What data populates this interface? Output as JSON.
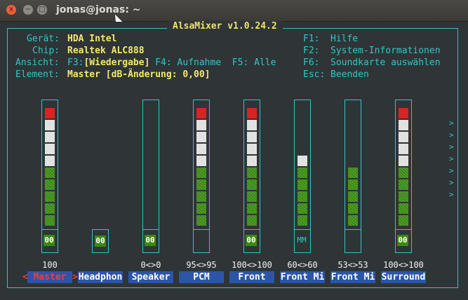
{
  "window": {
    "title": "jonas@jonas: ~",
    "close": "x",
    "min": "−",
    "max": "□"
  },
  "mixer": {
    "title": "AlsaMixer v1.0.24.2",
    "info": [
      {
        "key": "Gerät:",
        "value": "HDA Intel"
      },
      {
        "key": "Chip:",
        "value": "Realtek ALC888"
      },
      {
        "key": "Ansicht:",
        "value": "F3:[Wiedergabe] F4: Aufnahme  F5: Alle"
      },
      {
        "key": "Element:",
        "value": "Master [dB-Änderung: 0,00]"
      }
    ],
    "view_parts": {
      "f3": "F3:",
      "f3_val": "[Wiedergabe]",
      "f4": " F4: Aufnahme  F5: Alle"
    },
    "keys": [
      {
        "key": "F1:",
        "label": "Hilfe"
      },
      {
        "key": "F2:",
        "label": "System-Informationen"
      },
      {
        "key": "F6:",
        "label": "Soundkarte auswählen"
      },
      {
        "key": "Esc:",
        "label": "Beenden"
      }
    ],
    "channels": [
      {
        "name": "Master",
        "value": "100",
        "level": 100,
        "switch": "00",
        "selected": true
      },
      {
        "name": "Headphon",
        "value": "",
        "level": null,
        "switch": "00"
      },
      {
        "name": "Speaker",
        "value": "0<>0",
        "level": 0,
        "switch": "00"
      },
      {
        "name": "PCM",
        "value": "95<>95",
        "level": 95,
        "switch": ""
      },
      {
        "name": "Front",
        "value": "100<>100",
        "level": 100,
        "switch": "00"
      },
      {
        "name": "Front Mi",
        "value": "60<>60",
        "level": 60,
        "switch": "MM"
      },
      {
        "name": "Front Mi",
        "value": "53<>53",
        "level": 53,
        "switch": ""
      },
      {
        "name": "Surround",
        "value": "100<>100",
        "level": 100,
        "switch": "00"
      }
    ],
    "more_arrow": ">",
    "sel_left": "<",
    "sel_right": ">"
  },
  "colors": {
    "cyan": "#2ec8c8",
    "yellow": "#f3ea6a",
    "green": "#3a8a12",
    "white": "#e8e8e8",
    "red": "#e02424"
  }
}
